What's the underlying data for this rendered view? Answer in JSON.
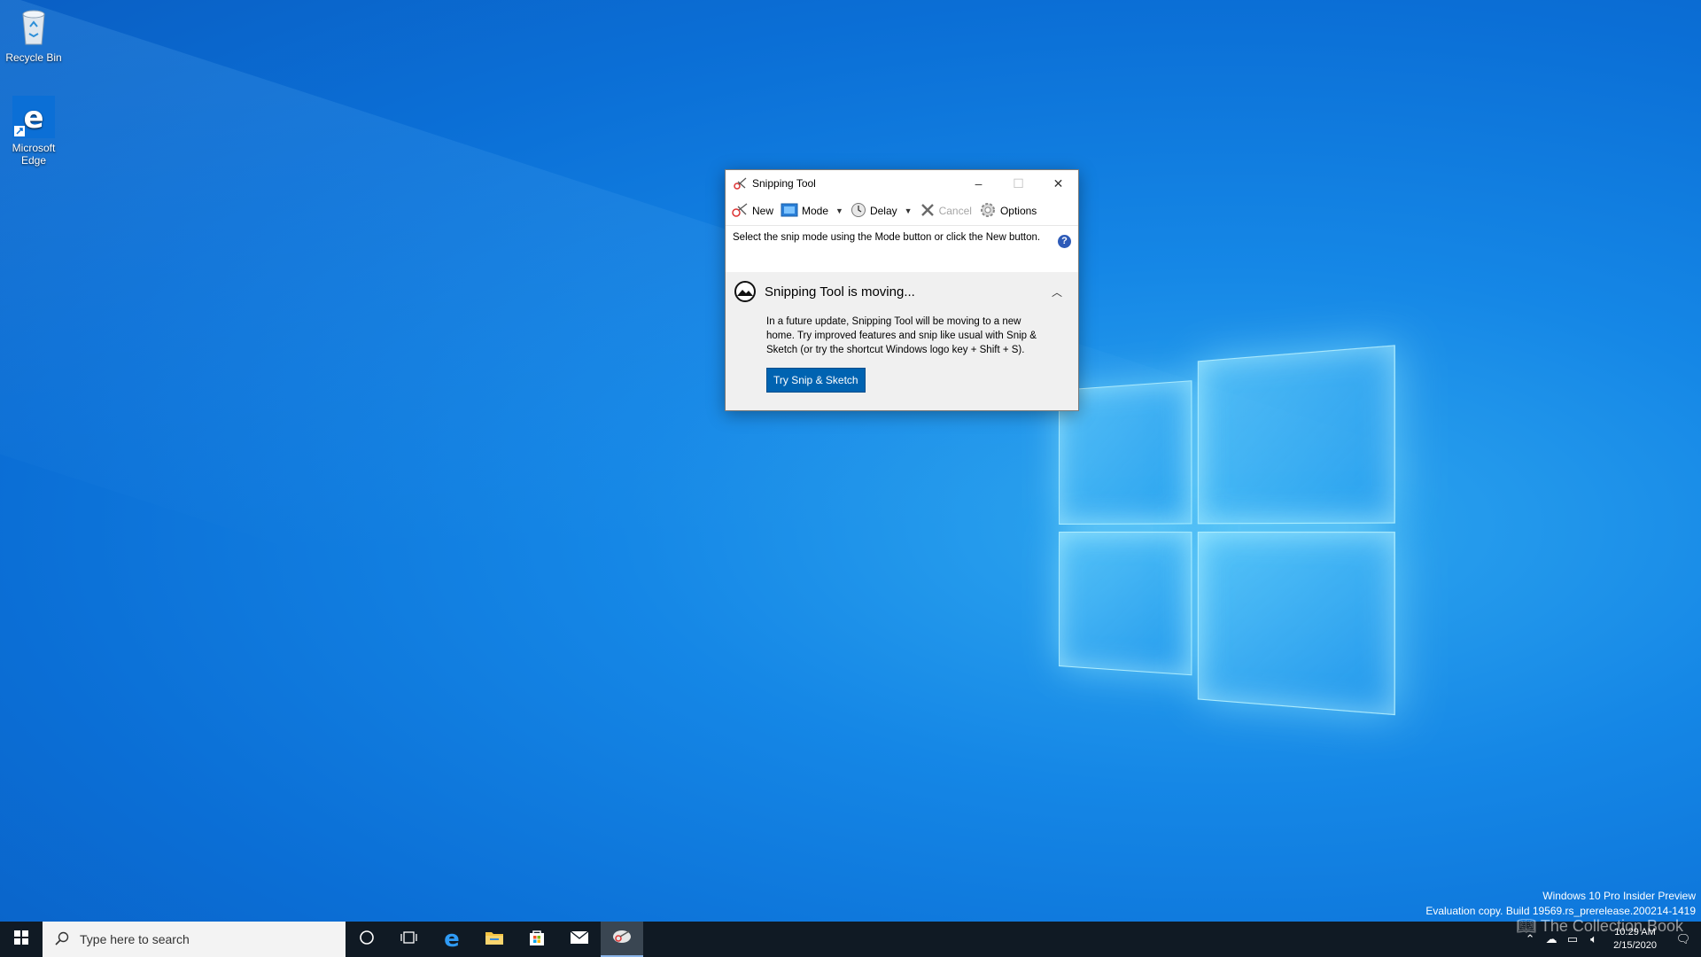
{
  "desktop": {
    "icons": [
      {
        "label": "Recycle Bin",
        "icon": "recycle-bin-icon"
      },
      {
        "label": "Microsoft Edge",
        "icon": "edge-icon"
      }
    ]
  },
  "snipping_tool": {
    "title": "Snipping Tool",
    "toolbar": {
      "new": "New",
      "mode": "Mode",
      "delay": "Delay",
      "cancel": "Cancel",
      "options": "Options"
    },
    "hint": "Select the snip mode using the Mode button or click the New button.",
    "notice": {
      "title": "Snipping Tool is moving...",
      "body": "In a future update, Snipping Tool will be moving to a new home. Try improved features and snip like usual with Snip & Sketch (or try the shortcut Windows logo key + Shift + S).",
      "button": "Try Snip & Sketch"
    }
  },
  "watermark": {
    "line1": "Windows 10 Pro Insider Preview",
    "line2": "Evaluation copy. Build 19569.rs_prerelease.200214-1419"
  },
  "taskbar": {
    "search_placeholder": "Type here to search",
    "time": "10:29 AM",
    "date": "2/15/2020",
    "overlay_text": "The Collection Book"
  },
  "colors": {
    "desktop_blue": "#1587e6",
    "accent": "#0063b1",
    "taskbar": "#101a24"
  }
}
